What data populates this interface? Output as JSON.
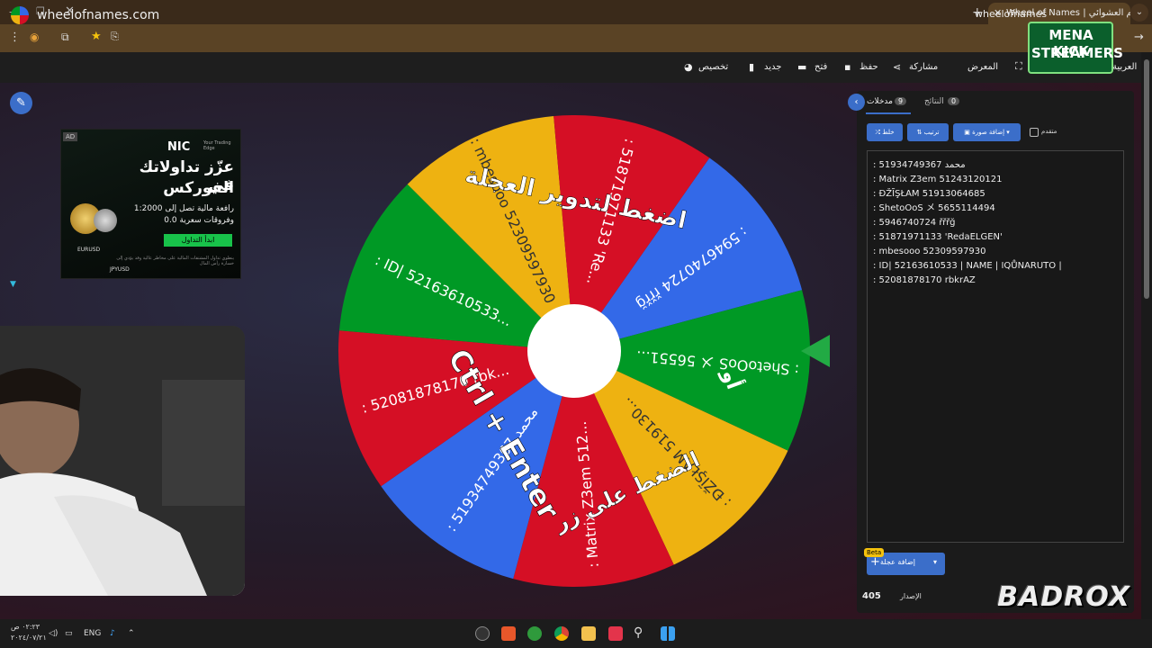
{
  "browser": {
    "tab_title": "Wheel of Names | سم العشوائي",
    "url": "wheelofnames"
  },
  "app": {
    "site_title": "wheelofnames.com",
    "menu": {
      "customize": "تخصيص",
      "new": "جديد",
      "open": "فتح",
      "save": "حفظ",
      "share": "مشاركة",
      "gallery": "المعرض",
      "language": "العربية"
    }
  },
  "ad": {
    "tag": "AD",
    "brand": "NIC",
    "brand_sub": "Your Trading Edge",
    "headline1": "عزّز تداولاتك في",
    "headline2": "الفوركس",
    "line1": "رافعة مالية تصل إلى 1:2000",
    "line2": "وفروقات سعرية 0.0",
    "cta": "ابدأ التداول",
    "pair1": "EURUSD",
    "pair2": "JPYUSD",
    "fine_print": "ينطوي تداول المشتقات المالية على مخاطر عالية وقد يؤدي إلى خسارة رأس المال"
  },
  "wheel": {
    "slices": [
      {
        "label": ": 5946740724 řřřğ",
        "color": "#3369e8"
      },
      {
        "label": ": ShetoOoS メ 56551...",
        "color": "#009925"
      },
      {
        "label": ": ĐŽĨŞŁAM 519130...",
        "color": "#eeb211"
      },
      {
        "label": ": Matrix Z3em 512...",
        "color": "#d50f25"
      },
      {
        "label": ": 51934749367 محمد",
        "color": "#3369e8"
      },
      {
        "label": ": 52081878170 rbk...",
        "color": "#d50f25"
      },
      {
        "label": ": ID| 52163610533...",
        "color": "#009925"
      },
      {
        "label": ": mbesooo 52309597930",
        "color": "#eeb211"
      },
      {
        "label": ": 51871971133 'Re...",
        "color": "#d50f25"
      }
    ],
    "overlay_top": "اضغط لتدوير العجلة",
    "overlay_or": "أو",
    "overlay_bottom_ar": "الضغط على زر",
    "overlay_keys": "Ctrl + Enter",
    "pointer_color": "#22aa44"
  },
  "panel": {
    "tab_entries_label": "مدخلات",
    "tab_entries_count": "9",
    "tab_results_label": "النتائج",
    "tab_results_count": "0",
    "shuffle_label": "خلط",
    "sort_label": "ترتيب",
    "add_image_label": "إضافة صورة",
    "advanced_label": "متقدم",
    "entries": [
      ": 51934749367 محمد",
      ": Matrix Z3em 51243120121",
      ": ĐŽĨŞŁAM 51913064685",
      ": ShetoOoS メ 5655114494",
      ": 5946740724 řřřğ",
      ": 51871971133 'RedaELGEN'",
      ": mbesooo 52309597930",
      ": ID| 52163610533 | NAME | IQŮNARUTO |",
      ": 52081878170 rbkrAZ"
    ],
    "beta": "Beta",
    "add_wheel_label": "إضافة عجلة",
    "version_label": "الإصدار",
    "version_num": "405"
  },
  "overlays": {
    "mena1": "MENA KICK",
    "mena2": "STREAMERS",
    "badrox": "BADROX"
  },
  "taskbar": {
    "lang": "ENG",
    "clock_time": "٠٢:٢٣ ص",
    "clock_date": "٢٠٢٤/٠٧/٢١"
  }
}
